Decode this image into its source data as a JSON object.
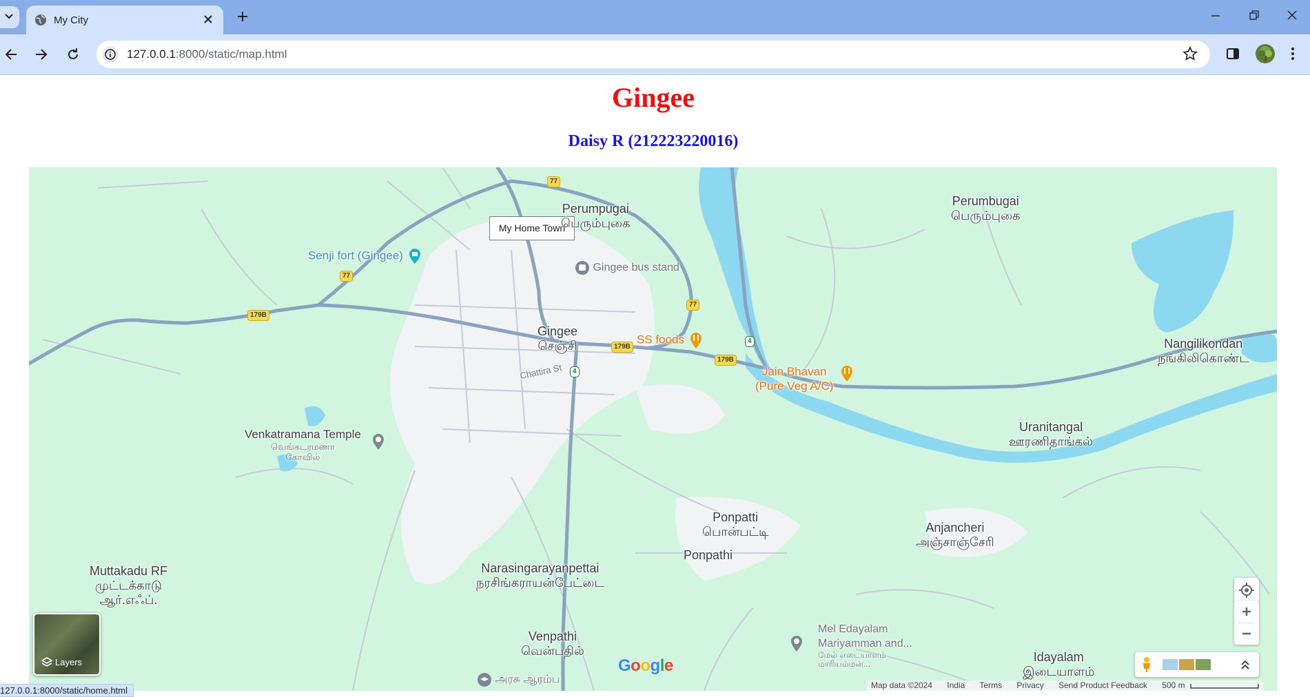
{
  "browser": {
    "tab_title": "My City",
    "url_host": "127.0.0.1",
    "url_rest": ":8000/static/map.html",
    "status_url": "127.0.0.1:8000/static/home.html"
  },
  "page": {
    "title": "Gingee",
    "subtitle": "Daisy R (212223220016)"
  },
  "map": {
    "info_window": "My Home Town",
    "labels": {
      "perumpugai_en": "Perumpugai",
      "perumpugai_ta": "பெரும்புகை",
      "perumbugai_en": "Perumbugai",
      "perumbugai_ta": "பெரும்புகை",
      "senji_fort": "Senji fort (Gingee)",
      "bus_stand": "Gingee bus stand",
      "gingee_en": "Gingee",
      "gingee_ta": "செஞ்சி",
      "ss_foods": "SS foods",
      "jain_bhavan_1": "Jain Bhavan",
      "jain_bhavan_2": "(Pure Veg A/C)",
      "chattira": "Chattira St",
      "venkatramana_en": "Venkatramana Temple",
      "venkatramana_ta1": "வெங்கடரமணா",
      "venkatramana_ta2": "கோவில்",
      "nangilikondan_en": "Nangilikondan",
      "nangilikondan_ta": "நங்கிலிகொண்ட",
      "uranitangal_en": "Uranitangal",
      "uranitangal_ta": "ஊரணிதாங்கல்",
      "ponpatti_en": "Ponpatti",
      "ponpatti_ta": "பொன்பட்டி",
      "ponpathi": "Ponpathi",
      "anjancheri_en": "Anjancheri",
      "anjancheri_ta": "அஞ்சாஞ்சேரி",
      "muttakadu_en": "Muttakadu RF",
      "muttakadu_ta1": "முட்டக்காடு",
      "muttakadu_ta2": "ஆர்.எஃப்.",
      "narasinga_en": "Narasingarayanpettai",
      "narasinga_ta": "நரசிங்கராயன்பேட்டை",
      "venpathi_en": "Venpathi",
      "venpathi_ta": "வென்பதில்",
      "mel_1": "Mel Edayalam",
      "mel_2": "Mariyamman and...",
      "mel_ta1": "மேல் எடையாளம்",
      "mel_ta2": "மாரியம்மன்...",
      "idayalam_en": "Idayalam",
      "idayalam_ta": "இடையாளம்",
      "arasu": "அரசு ஆரம்ப"
    },
    "shields": {
      "r77": "77",
      "r179b": "179B",
      "r4": "4"
    },
    "layers_label": "Layers",
    "google_logo": [
      "G",
      "o",
      "o",
      "g",
      "l",
      "e"
    ],
    "attribution": {
      "map_data": "Map data ©2024",
      "country": "India",
      "terms": "Terms",
      "privacy": "Privacy",
      "feedback": "Send Product Feedback",
      "scale": "500 m"
    }
  },
  "colors": {
    "title": "#f00f0f",
    "subtitle": "#1515e6",
    "land": "#d2f5e0",
    "water": "#8bd8f0",
    "road": "#8aa2c0"
  }
}
